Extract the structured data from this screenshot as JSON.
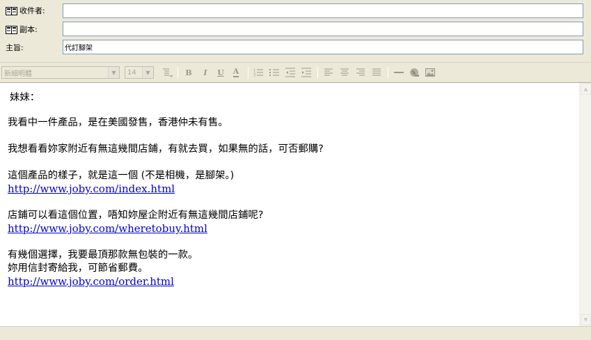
{
  "header": {
    "to_label": "收件者:",
    "to_value": "",
    "cc_label": "副本:",
    "cc_value": "",
    "subject_label": "主旨:",
    "subject_value": "代訂腳架"
  },
  "toolbar": {
    "font_name": "新細明體",
    "font_size": "14",
    "buttons": [
      "paragraph-style",
      "bold",
      "italic",
      "underline",
      "font-color",
      "numbered-list",
      "bulleted-list",
      "decrease-indent",
      "increase-indent",
      "align-left",
      "align-center",
      "align-right",
      "justify",
      "horizontal-line",
      "insert-link",
      "insert-picture"
    ],
    "bold_glyph": "B",
    "italic_glyph": "I",
    "underline_glyph": "U",
    "fontcolor_glyph": "A"
  },
  "message": {
    "greeting": "妹妹：",
    "line1": "我看中一件產品，是在美國發售，香港仲未有售。",
    "line2": "我想看看妳家附近有無這幾間店鋪，有就去買，如果無的話，可否郵購?",
    "line3": "這個產品的樣子，就是這一個 (不是相機，是腳架。)",
    "link1": "http://www.joby.com/index.html",
    "line4": "店鋪可以看這個位置，唔知妳屋企附近有無這幾間店鋪呢?",
    "link2": "http://www.joby.com/wheretobuy.html",
    "line5": "有幾個選擇，我要最頂那款無包裝的一款。",
    "line6": "妳用信封寄給我，可節省郵費。",
    "link3": "http://www.joby.com/order.html"
  },
  "colors": {
    "chrome": "#ece9d8",
    "input_border": "#7f9db9",
    "link": "#0000cc",
    "disabled_text": "#aca899"
  }
}
